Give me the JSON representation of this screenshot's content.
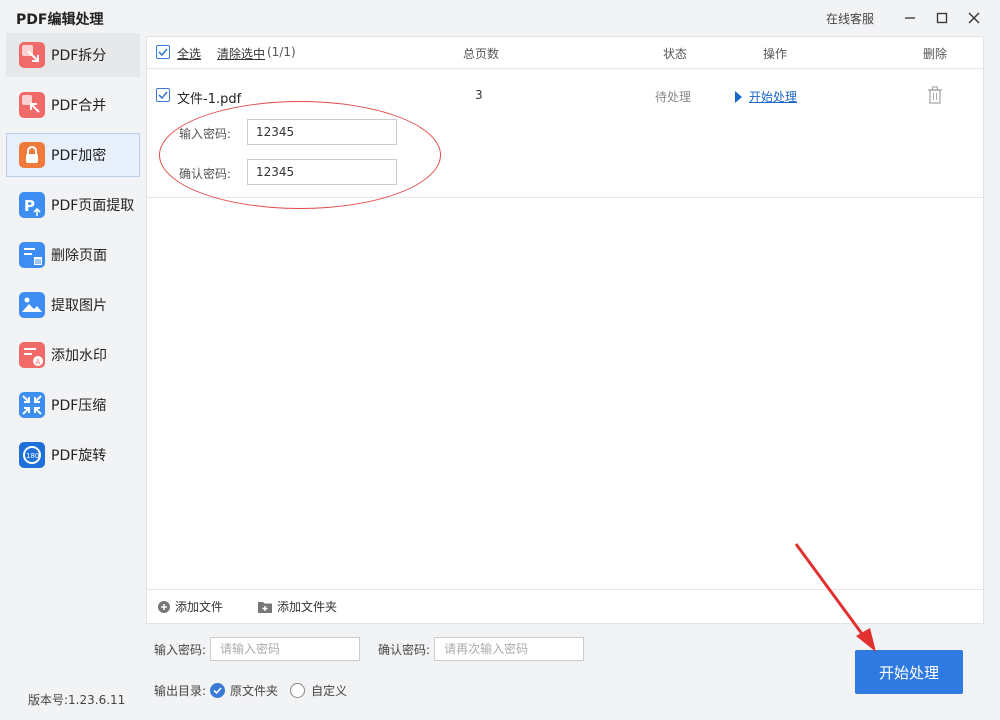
{
  "app": {
    "title": "PDF编辑处理",
    "service": "在线客服",
    "version": "版本号:1.23.6.11"
  },
  "sidebar": {
    "items": [
      {
        "label": "PDF拆分"
      },
      {
        "label": "PDF合并"
      },
      {
        "label": "PDF加密"
      },
      {
        "label": "PDF页面提取"
      },
      {
        "label": "删除页面"
      },
      {
        "label": "提取图片"
      },
      {
        "label": "添加水印"
      },
      {
        "label": "PDF压缩"
      },
      {
        "label": "PDF旋转"
      }
    ]
  },
  "table": {
    "select_all": "全选",
    "clear_selection": "清除选中",
    "selection_count": "(1/1)",
    "columns": {
      "pages": "总页数",
      "status": "状态",
      "action": "操作",
      "delete": "删除"
    },
    "rows": [
      {
        "filename": "文件-1.pdf",
        "pages": "3",
        "status": "待处理",
        "action": "开始处理",
        "password_label": "输入密码:",
        "password_value": "12345",
        "confirm_label": "确认密码:",
        "confirm_value": "12345"
      }
    ]
  },
  "footer": {
    "add_file": "添加文件",
    "add_folder": "添加文件夹"
  },
  "settings": {
    "password_label": "输入密码:",
    "password_placeholder": "请输入密码",
    "confirm_label": "确认密码:",
    "confirm_placeholder": "请再次输入密码",
    "output_label": "输出目录:",
    "output_options": [
      "原文件夹",
      "自定义"
    ],
    "output_selected": "原文件夹"
  },
  "start_button": "开始处理",
  "colors": {
    "accent": "#2e7ae0",
    "annotation": "#e03030"
  }
}
